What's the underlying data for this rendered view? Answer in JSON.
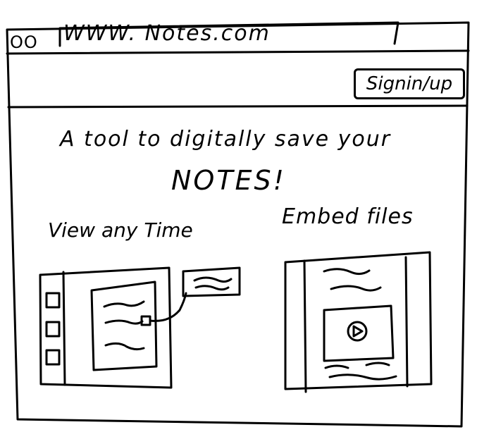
{
  "browser": {
    "window_dots": "OO",
    "url": "WWW. Notes.com"
  },
  "header": {
    "signin_label": "Signin/up"
  },
  "hero": {
    "tagline": "A tool to digitally save your",
    "highlight": "NOTES!"
  },
  "features": [
    {
      "title": "View any Time",
      "icon": "notes-viewer-sketch-icon"
    },
    {
      "title": "Embed files",
      "icon": "embedded-video-sketch-icon"
    }
  ]
}
